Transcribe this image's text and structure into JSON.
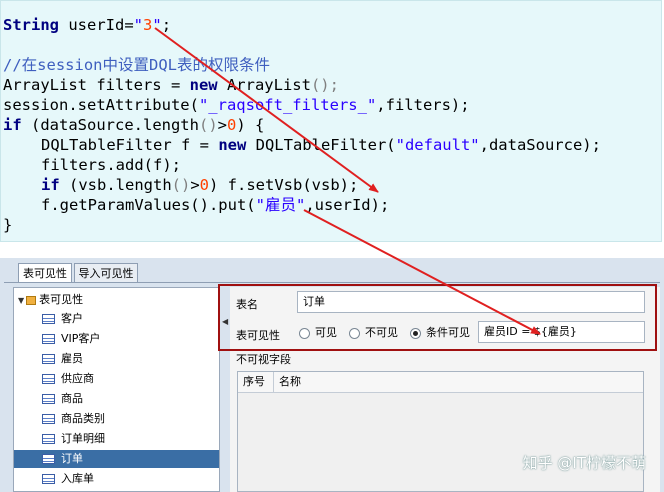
{
  "code": {
    "line1": {
      "kw": "String",
      "mid": " userId=",
      "q1": "\"",
      "num": "3",
      "q2": "\"",
      "end": ";"
    },
    "comment": "//在session中设置DQL表的权限条件",
    "line3": {
      "a": "ArrayList filters = ",
      "kw": "new",
      "b": " ArrayList",
      "p": "();"
    },
    "line4": {
      "a": "session.setAttribute(",
      "s": "\"_raqsoft_filters_\"",
      "b": ",filters);"
    },
    "line5": {
      "kw": "if",
      "a": " (dataSource.length",
      "p": "()",
      "g": ">",
      "n": "0",
      "b": ") {"
    },
    "line6": {
      "a": "DQLTableFilter f = ",
      "kw": "new",
      "b": " DQLTableFilter(",
      "s": "\"default\"",
      "c": ",dataSource);"
    },
    "line7": {
      "a": "filters.add(f);"
    },
    "line8": {
      "kw": "if",
      "a": " (vsb.length",
      "p": "()",
      "g": ">",
      "n": "0",
      "b": ") f.setVsb(vsb);"
    },
    "line9": {
      "a": "f.getParamValues().put(",
      "s": "\"雇员\"",
      "b": ",userId);"
    },
    "close": "}"
  },
  "tabs": {
    "active": "表可见性",
    "inactive": "导入可见性"
  },
  "tree": {
    "root": "表可见性",
    "items": [
      "客户",
      "VIP客户",
      "雇员",
      "供应商",
      "商品",
      "商品类别",
      "订单明细",
      "订单",
      "入库单"
    ],
    "selected": "订单"
  },
  "form": {
    "table_name_label": "表名",
    "table_name_value": "订单",
    "visibility_label": "表可见性",
    "options": [
      "可见",
      "不可见",
      "条件可见"
    ],
    "selected_option": "条件可见",
    "condition_value": "雇员ID = ${雇员}",
    "invisible_fields_label": "不可视字段",
    "columns": [
      "序号",
      "名称"
    ]
  },
  "watermark": "知乎 @IT柠檬不萌",
  "colors": {
    "annotation": "#e02020",
    "selection": "#3a6ea5",
    "code_bg": "#e6f8fa"
  }
}
